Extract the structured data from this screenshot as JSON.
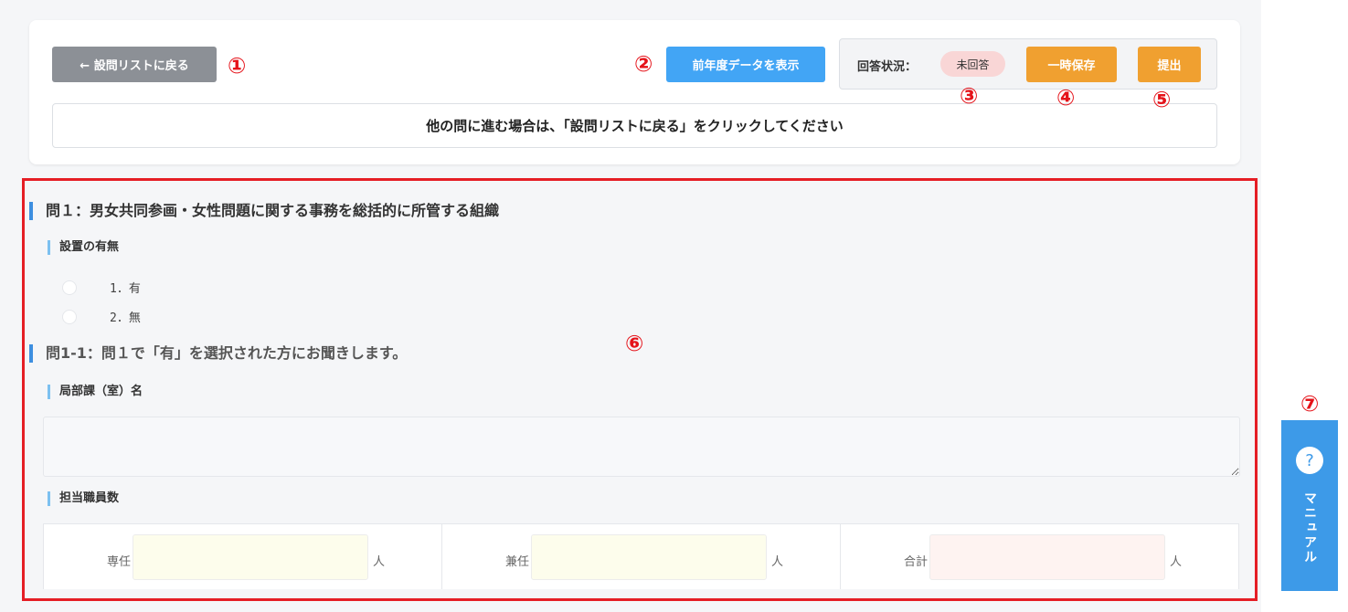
{
  "toolbar": {
    "back_label": "← 設問リストに戻る",
    "prev_year_label": "前年度データを表示",
    "status_label": "回答状況：",
    "status_value": "未回答",
    "save_label": "一時保存",
    "submit_label": "提出"
  },
  "notice": "他の問に進む場合は、「設問リストに戻る」をクリックしてください",
  "markers": [
    "①",
    "②",
    "③",
    "④",
    "⑤",
    "⑥",
    "⑦"
  ],
  "question1": {
    "title": "問１：男女共同参画・女性問題に関する事務を総括的に所管する組織",
    "subtitle": "設置の有無",
    "options": [
      "1．有",
      "2．無"
    ]
  },
  "question1_1": {
    "title": "問1-1：問１で「有」を選択された方にお聞きします。",
    "dept_label": "局部課（室）名",
    "staff_label": "担当職員数",
    "staff": [
      {
        "label": "専任",
        "unit": "人"
      },
      {
        "label": "兼任",
        "unit": "人"
      },
      {
        "label": "合計",
        "unit": "人"
      }
    ]
  },
  "manual": {
    "label": "マニュアル",
    "icon": "question-icon"
  },
  "colors": {
    "accent_blue": "#42a5f5",
    "orange": "#f0a030",
    "grey_button": "#8c9096",
    "annotation_red": "#e51e25",
    "senin_bg": "#fdfdec",
    "kennin_bg": "#fdfdec",
    "total_bg": "#fef3f1"
  }
}
